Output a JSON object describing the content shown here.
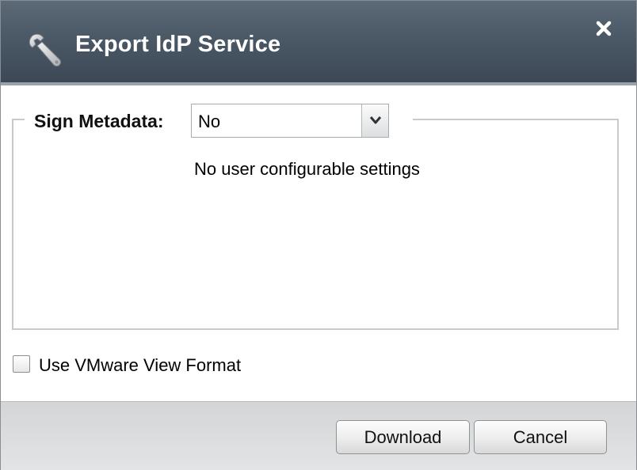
{
  "dialog": {
    "title": "Export IdP Service",
    "title_icon": "wrench-icon",
    "close_icon": "close-icon"
  },
  "sign_metadata": {
    "label": "Sign Metadata:",
    "selected": "No",
    "options": [
      "No"
    ]
  },
  "settings": {
    "message": "No user configurable settings"
  },
  "vmware_view": {
    "label": "Use VMware View Format",
    "checked": false
  },
  "buttons": {
    "download": "Download",
    "cancel": "Cancel"
  },
  "colors": {
    "titlebar": "#4b5866",
    "title_text": "#ffffff",
    "footer": "#dcdddf"
  }
}
